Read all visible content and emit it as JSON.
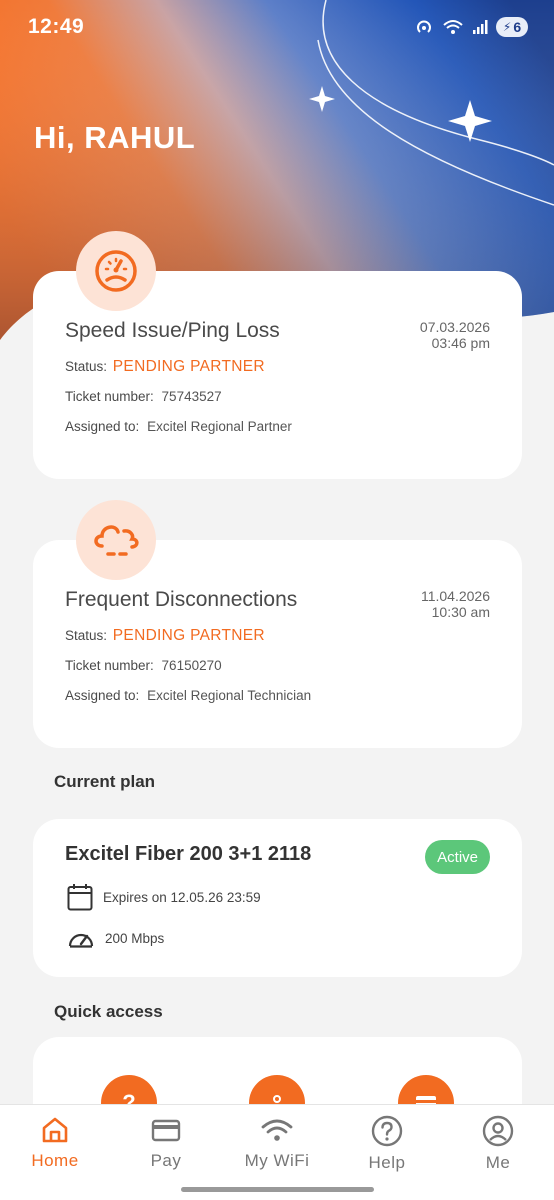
{
  "status_bar": {
    "time": "12:49",
    "battery": "6",
    "icons": [
      "hotspot-icon",
      "wifi-icon",
      "signal-icon",
      "battery-charging-icon"
    ]
  },
  "greeting": "Hi, RAHUL",
  "tickets": [
    {
      "icon": "speedometer-icon",
      "title": "Speed Issue/Ping Loss",
      "date": "07.03.2026",
      "time": "03:46 pm",
      "status_label": "Status:",
      "status_value": "PENDING PARTNER",
      "ticket_label": "Ticket number:",
      "ticket_value": "75743527",
      "assigned_label": "Assigned to:",
      "assigned_value": "Excitel Regional Partner"
    },
    {
      "icon": "cloud-disconnect-icon",
      "title": "Frequent Disconnections",
      "date": "11.04.2026",
      "time": "10:30 am",
      "status_label": "Status:",
      "status_value": "PENDING PARTNER",
      "ticket_label": "Ticket number:",
      "ticket_value": "76150270",
      "assigned_label": "Assigned to:",
      "assigned_value": "Excitel Regional Technician"
    }
  ],
  "current_plan": {
    "section_title": "Current plan",
    "name": "Excitel Fiber 200 3+1 2118",
    "badge": "Active",
    "expires": "Expires on 12.05.26 23:59",
    "speed": "200 Mbps"
  },
  "quick_access": {
    "section_title": "Quick access",
    "icons": [
      "help-icon",
      "technician-icon",
      "card-icon"
    ]
  },
  "bottom_nav": {
    "items": [
      {
        "label": "Home",
        "icon": "home-icon",
        "active": true
      },
      {
        "label": "Pay",
        "icon": "credit-card-icon",
        "active": false
      },
      {
        "label": "My WiFi",
        "icon": "wifi-icon",
        "active": false
      },
      {
        "label": "Help",
        "icon": "help-circle-icon",
        "active": false
      },
      {
        "label": "Me",
        "icon": "profile-icon",
        "active": false
      }
    ]
  },
  "colors": {
    "accent": "#f26b21",
    "hero_blue": "#1f4fa8",
    "active_badge": "#5cc77a"
  }
}
